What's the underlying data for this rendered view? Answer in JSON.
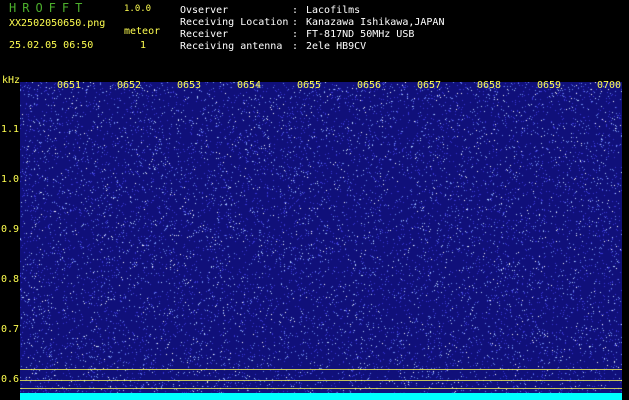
{
  "app": {
    "title": "HROFFT",
    "version": "1.0.0"
  },
  "file_name": "XX2502050650.png",
  "timestamp": "25.02.05 06:50",
  "meteor": {
    "label": "meteor",
    "count": "1"
  },
  "info": [
    {
      "key": "Ovserver",
      "value": "Lacofilms"
    },
    {
      "key": "Receiving Location",
      "value": "Kanazawa Ishikawa,JAPAN"
    },
    {
      "key": "Receiver",
      "value": "FT-817ND 50MHz USB"
    },
    {
      "key": "Receiving antenna",
      "value": "2ele HB9CV"
    }
  ],
  "axes": {
    "y_unit": "kHz",
    "y_ticks": [
      "1.1",
      "1.0",
      "0.9",
      "0.8",
      "0.7",
      "0.6"
    ],
    "x_ticks": [
      "0651",
      "0652",
      "0653",
      "0654",
      "0655",
      "0656",
      "0657",
      "0658",
      "0659",
      "0700"
    ]
  },
  "colors": {
    "label": "#ffff50",
    "title": "#4caf2c",
    "background": "#10107a",
    "noise": "#ffffff",
    "baseline": "#00ffff"
  }
}
